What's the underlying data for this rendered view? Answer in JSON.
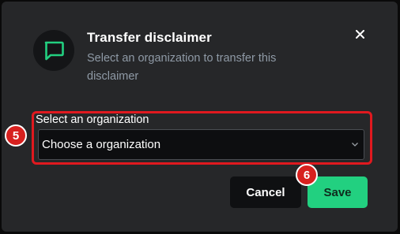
{
  "dialog": {
    "title": "Transfer disclaimer",
    "subtitle": "Select an organization to transfer this disclaimer",
    "close_label": "×"
  },
  "form": {
    "label": "Select an organization",
    "selected_value": "Choose a organization"
  },
  "buttons": {
    "cancel_label": "Cancel",
    "save_label": "Save"
  },
  "annotations": {
    "step_5": "5",
    "step_6": "6"
  },
  "colors": {
    "accent_green": "#22d080",
    "highlight_red": "#e0191f",
    "modal_bg": "#262729"
  },
  "icons": {
    "dialog_icon": "chat-bubble-icon",
    "close_icon": "close-icon",
    "select_icon": "chevron-down-icon"
  }
}
